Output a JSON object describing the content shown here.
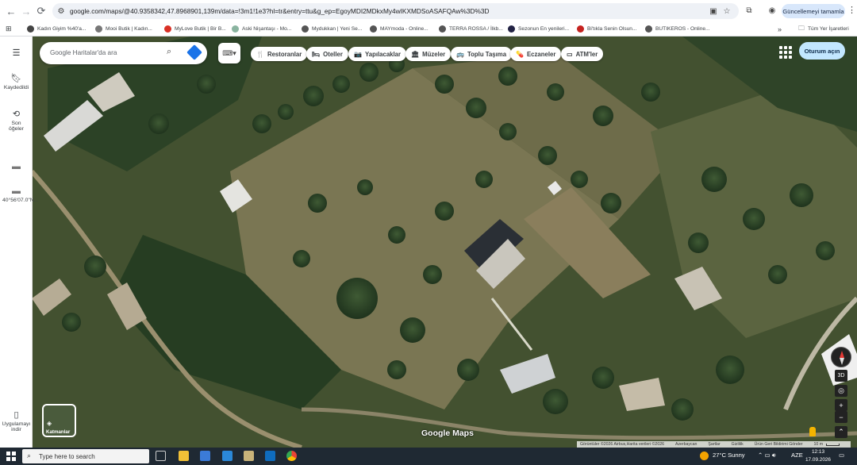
{
  "browser": {
    "url": "google.com/maps/@40.9358342,47.8968901,139m/data=!3m1!1e3?hl=tr&entry=ttu&g_ep=EgoyMDI2MDkxMy4wIKXMDSoASAFQAw%3D%3D",
    "update_label": "Güncellemeyi tamamla",
    "all_bookmarks": "Tüm Yer İşaretleri",
    "bookmarks": [
      {
        "label": "Kadın Giyim %40'a...",
        "color": "#444444"
      },
      {
        "label": "Mooi Butik | Kadın...",
        "color": "#777777"
      },
      {
        "label": "MyLove Butik | Bir B...",
        "color": "#d93025"
      },
      {
        "label": "Aski Nişantaşı - Mo...",
        "color": "#8ab4a0"
      },
      {
        "label": "Mydukkan | Yeni Se...",
        "color": "#555555"
      },
      {
        "label": "MAYmoda - Online...",
        "color": "#555555"
      },
      {
        "label": "TERRA ROSSA / İlkb...",
        "color": "#555555"
      },
      {
        "label": "Sezonun En yenileri...",
        "color": "#222244"
      },
      {
        "label": "Bi'tıkla Senin Olsun...",
        "color": "#c5221f"
      },
      {
        "label": "BUTIKEROS - Online...",
        "color": "#555555"
      }
    ]
  },
  "rail": {
    "saved": "Kaydedildi",
    "recent": "Son öğeler",
    "coords": "40°56'07.0\"N...",
    "app_download": "Uygulamayı indir"
  },
  "search": {
    "placeholder": "Google Haritalar'da ara"
  },
  "chips": [
    {
      "icon": "restaurant-icon",
      "glyph": "🍴",
      "label": "Restoranlar"
    },
    {
      "icon": "hotel-icon",
      "glyph": "🛏",
      "label": "Oteller"
    },
    {
      "icon": "camera-icon",
      "glyph": "📷",
      "label": "Yapılacaklar"
    },
    {
      "icon": "museum-icon",
      "glyph": "🏛",
      "label": "Müzeler"
    },
    {
      "icon": "transit-icon",
      "glyph": "🚌",
      "label": "Toplu Taşıma"
    },
    {
      "icon": "pharmacy-icon",
      "glyph": "💊",
      "label": "Eczaneler"
    },
    {
      "icon": "atm-icon",
      "glyph": "▭",
      "label": "ATM'ler"
    }
  ],
  "signin": "Oturum açın",
  "layers": "Katmanlar",
  "controls": {
    "tilt": "3D"
  },
  "logo": "Google Maps",
  "attribution": {
    "imagery": "Görüntüler ©2026 Airbus,Harita verileri ©2026",
    "country": "Azerbaycan",
    "terms": "Şartlar",
    "privacy": "Gizlilik",
    "feedback": "Ürün Geri Bildirimi Gönder",
    "scale": "10 m"
  },
  "taskbar": {
    "search_placeholder": "Type here to search",
    "weather": "27°C  Sunny",
    "lang": "AZE",
    "time": "12:13",
    "date": "17.09.2026"
  }
}
